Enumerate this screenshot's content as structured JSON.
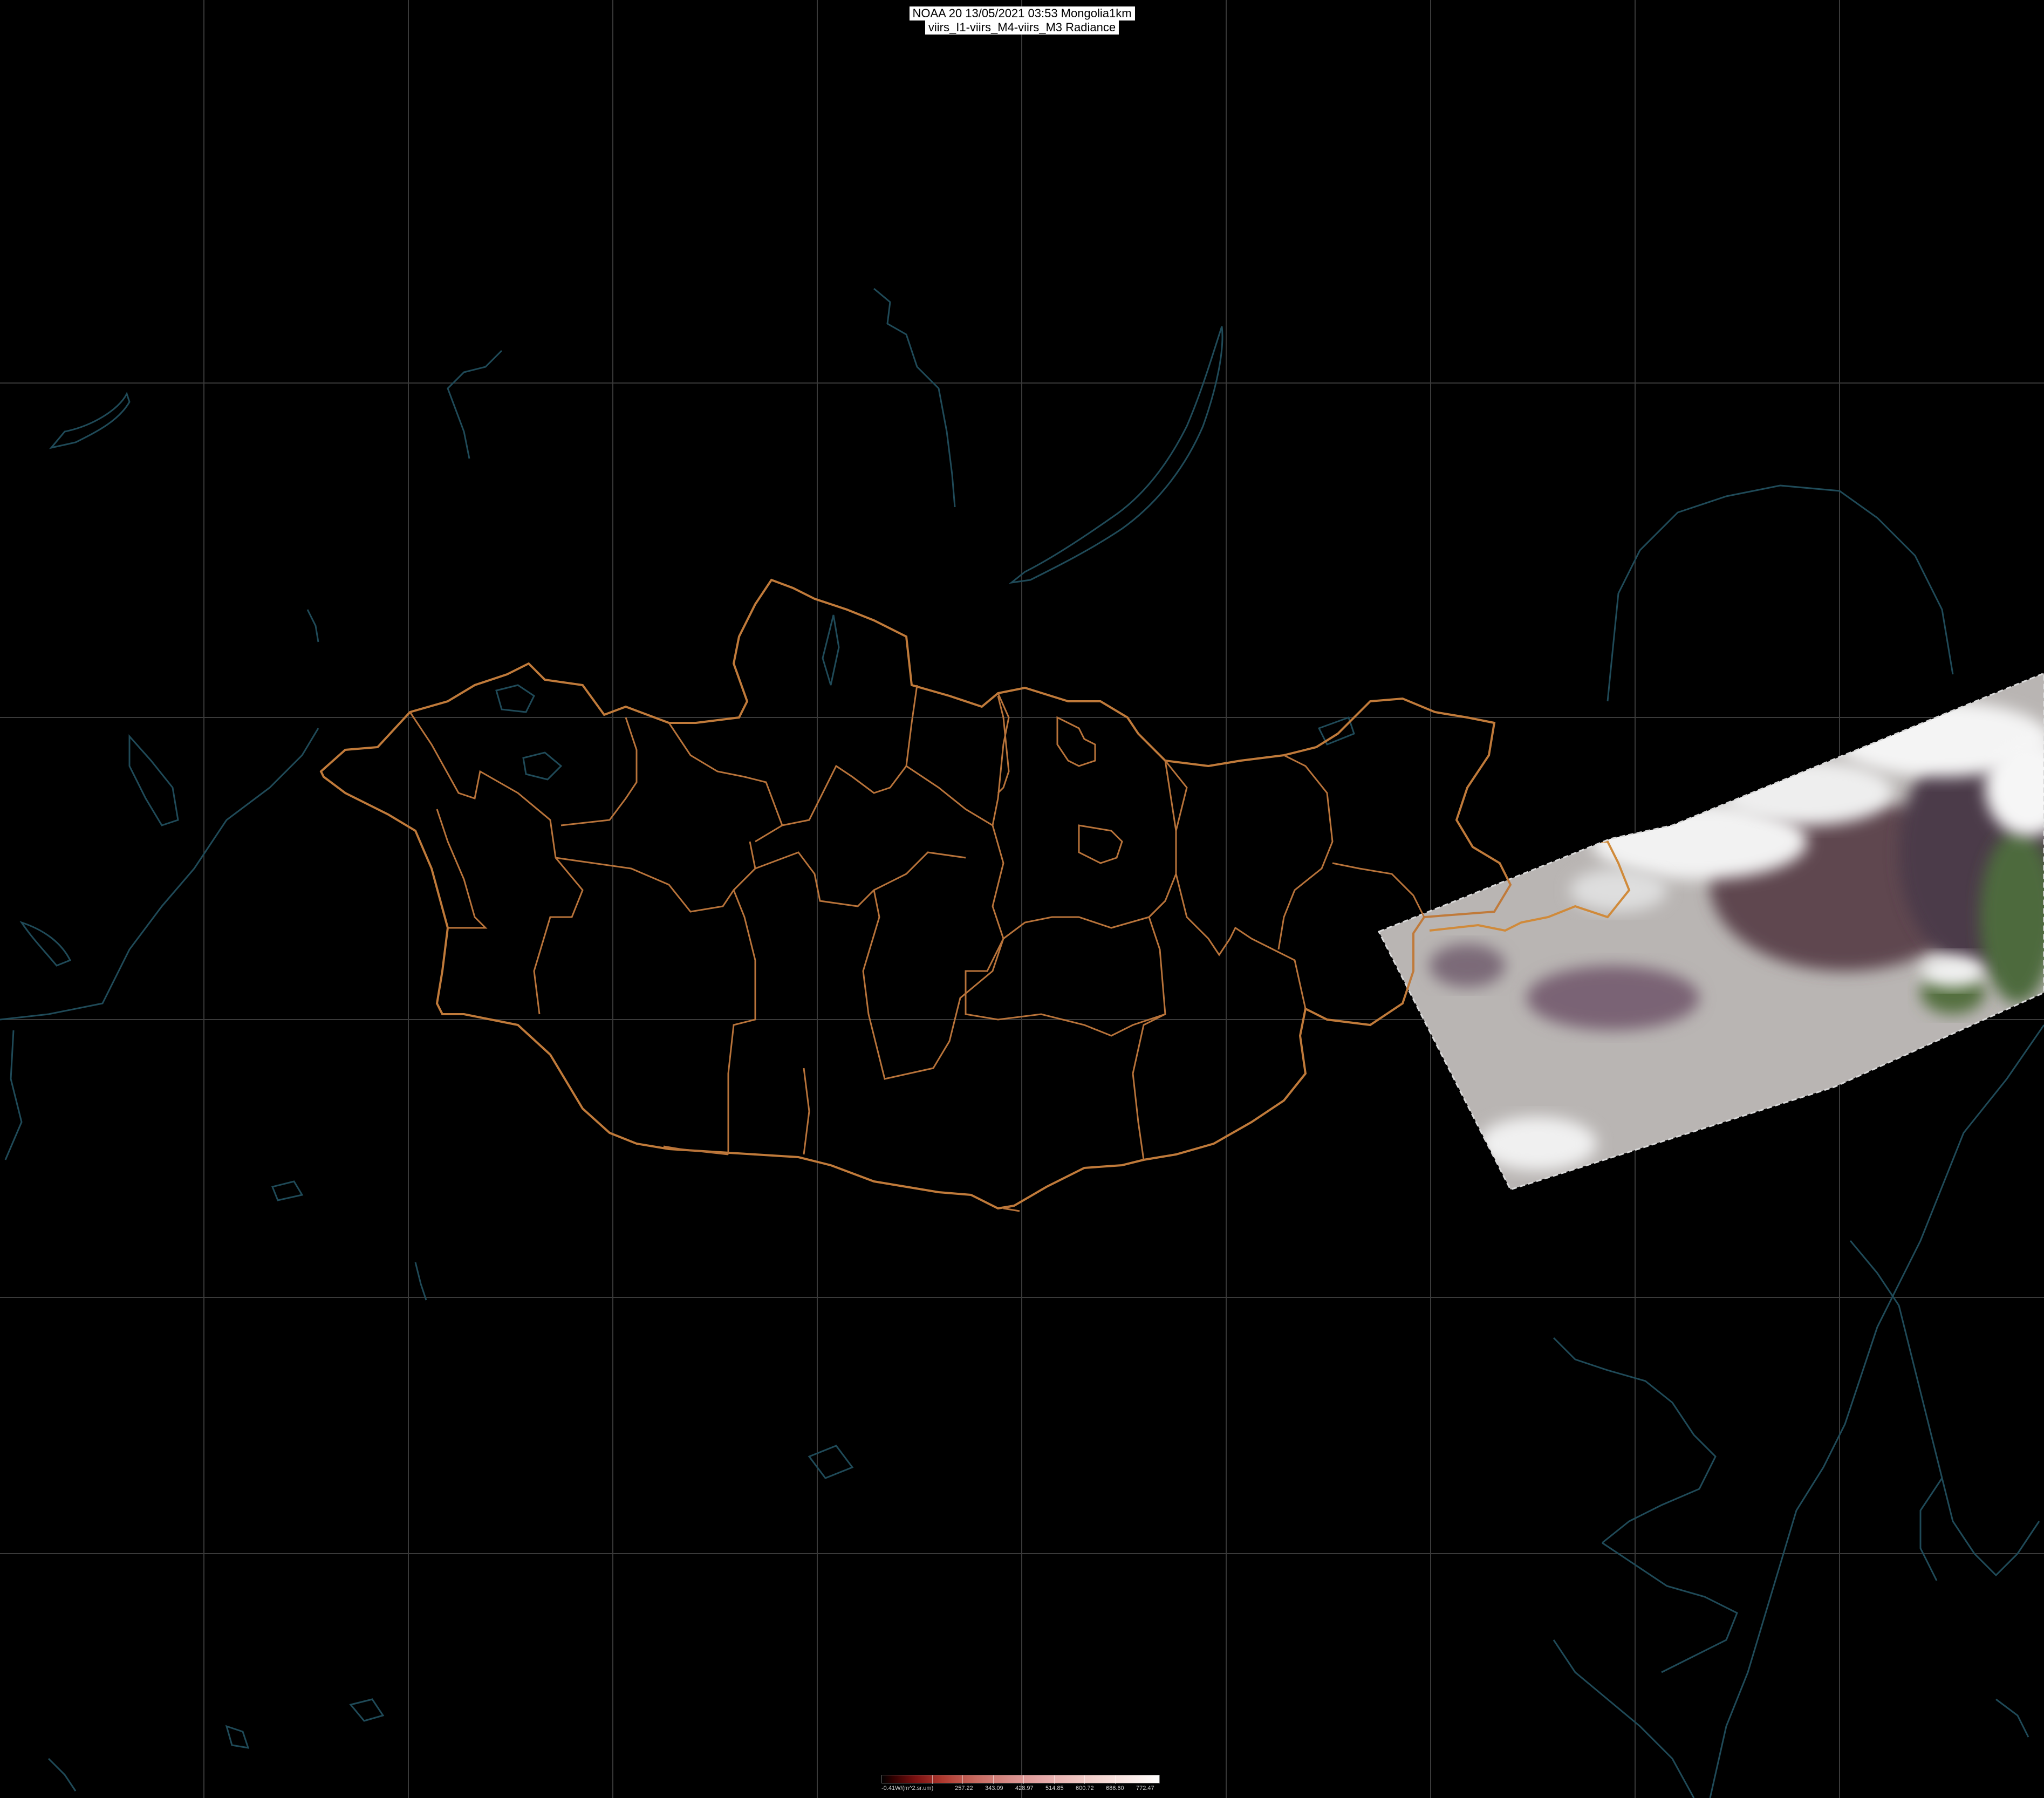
{
  "header": {
    "title_line1": "NOAA 20 13/05/2021 03:53 Mongolia1km",
    "title_line2": "viirs_I1-viirs_M4-viirs_M3 Radiance"
  },
  "legend": {
    "labels": [
      "-0.41W/(m^2.sr.um)",
      "257.22",
      "343.09",
      "428.97",
      "514.85",
      "600.72",
      "686.60",
      "772.47"
    ]
  },
  "colors": {
    "background": "#000000",
    "graticule": "#3a3a3a",
    "coastline": "#1f4a58",
    "mongolia_border": "#c07a3a",
    "aimag_border": "#b8733a",
    "swath_haze": "#b9b5b3",
    "swath_cloud": "#f2f2f2",
    "swath_soil": "#5e4650",
    "swath_vegetation": "#4e6a3c"
  },
  "map": {
    "region": "Mongolia",
    "layers": [
      "graticule",
      "coastlines-and-lakes",
      "national-border",
      "province-borders",
      "satellite-swath"
    ]
  }
}
